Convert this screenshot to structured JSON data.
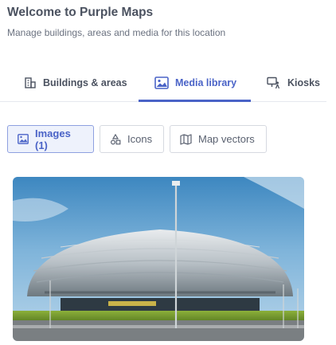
{
  "header": {
    "title": "Welcome to Purple Maps",
    "subtitle": "Manage buildings, areas and media for this location"
  },
  "tabs": [
    {
      "label": "Buildings & areas",
      "icon": "building-icon",
      "active": false
    },
    {
      "label": "Media library",
      "icon": "image-icon",
      "active": true
    },
    {
      "label": "Kiosks",
      "icon": "kiosk-icon",
      "active": false
    }
  ],
  "filters": [
    {
      "label": "Images (1)",
      "icon": "image-icon",
      "active": true
    },
    {
      "label": "Icons",
      "icon": "shapes-icon",
      "active": false
    },
    {
      "label": "Map vectors",
      "icon": "map-icon",
      "active": false
    }
  ],
  "media": {
    "images": [
      {
        "subject": "domed-arena-photo"
      }
    ]
  },
  "colors": {
    "accent": "#4a63c7",
    "title_text": "#4b5260",
    "muted_text": "#6b7280",
    "active_chip_bg": "#eef2fc"
  }
}
